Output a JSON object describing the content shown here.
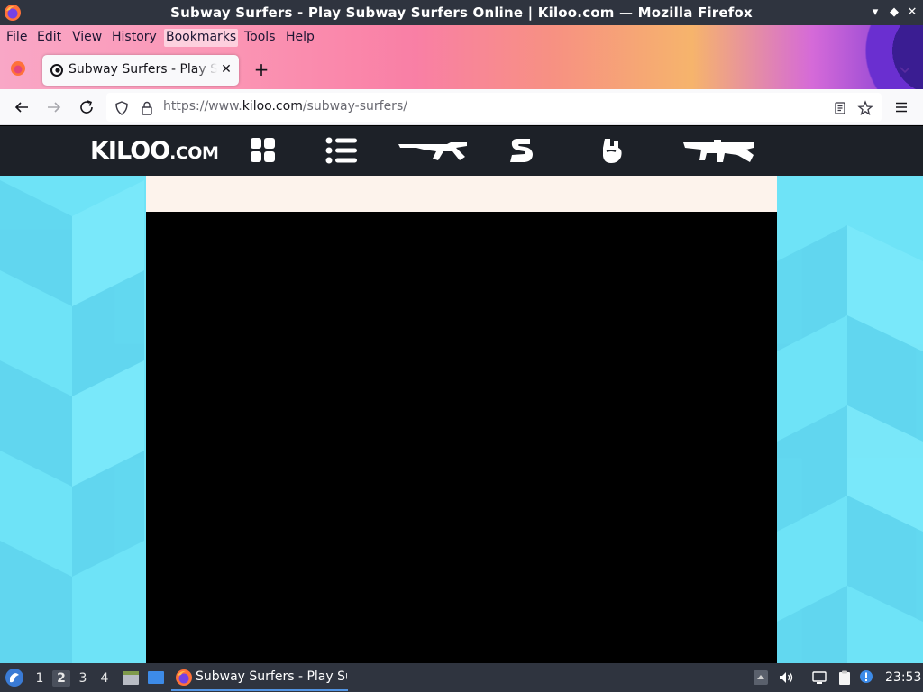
{
  "window": {
    "title": "Subway Surfers - Play Subway Surfers Online | Kiloo.com — Mozilla Firefox",
    "controls": [
      "minimize-icon",
      "maximize-icon",
      "close-icon"
    ]
  },
  "menubar": {
    "items": [
      {
        "label": "File"
      },
      {
        "label": "Edit"
      },
      {
        "label": "View"
      },
      {
        "label": "History"
      },
      {
        "label": "Bookmarks",
        "active": true
      },
      {
        "label": "Tools"
      },
      {
        "label": "Help"
      }
    ]
  },
  "tabs": [
    {
      "title": "Subway Surfers - Play Subway Surfers Online | Kiloo.com",
      "favicon": "kiloo-favicon-icon",
      "close_label": "✕"
    }
  ],
  "newtab_label": "+",
  "navbar": {
    "url_prefix": "https://www.",
    "url_domain": "kiloo.com",
    "url_path": "/subway-surfers/"
  },
  "site": {
    "logo_main": "KILOO",
    "logo_suffix": ".COM",
    "nav_icons": [
      "grid-icon",
      "list-icon",
      "rifle-icon",
      "s-logo-icon",
      "fist-icon",
      "submachine-gun-icon"
    ],
    "colors": {
      "nav_bg": "#1d2128",
      "page_bg": "#6ee3f7",
      "panel": "#000000",
      "panel_top": "#fdf3ec"
    }
  },
  "taskbar": {
    "workspaces": [
      {
        "label": "1"
      },
      {
        "label": "2",
        "active": true
      },
      {
        "label": "3"
      },
      {
        "label": "4"
      }
    ],
    "task_label": "Subway Surfers - Play Subway Surfers Online | Kiloo.com — Mozilla Firefox",
    "clock": "23:53"
  }
}
